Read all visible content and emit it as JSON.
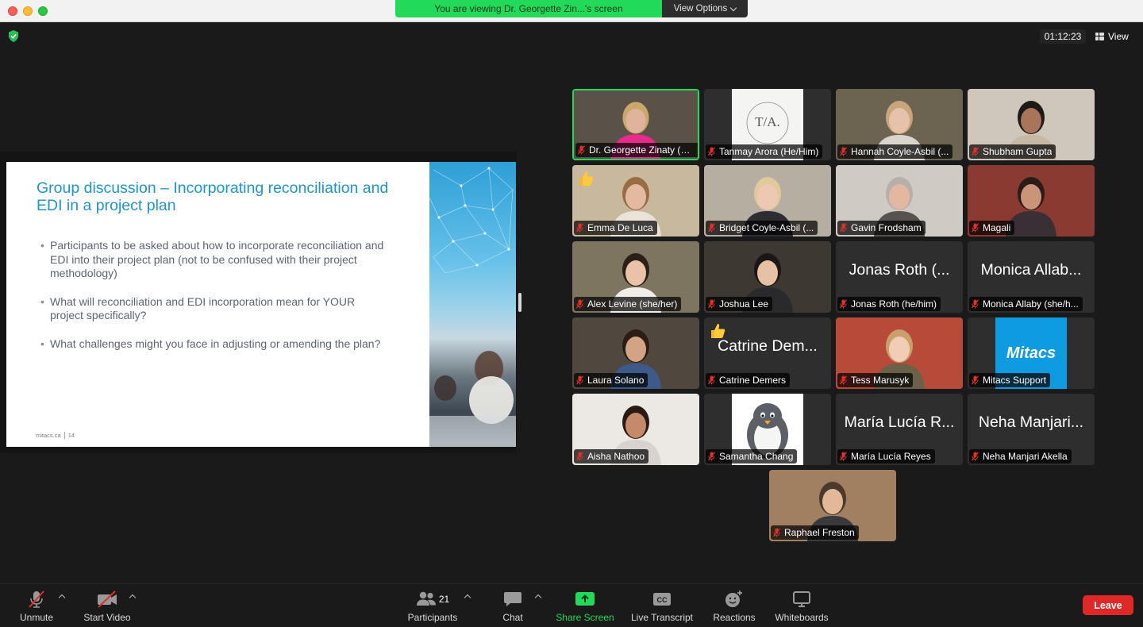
{
  "banner": {
    "text": "You are viewing Dr. Georgette Zin...'s screen",
    "view_options": "View Options"
  },
  "header": {
    "timer": "01:12:23",
    "view_label": "View"
  },
  "slide": {
    "title": "Group discussion – Incorporating reconciliation and EDI in a project plan",
    "bullets": [
      "Participants to be asked about how to incorporate reconciliation and EDI into their project plan (not to be confused with their project methodology)",
      "What will reconciliation and EDI incorporation mean for YOUR project specifically?",
      "What challenges might you face in adjusting or amending the plan?"
    ],
    "footer_site": "mitacs.ca",
    "footer_page": "14"
  },
  "participants": [
    {
      "name": "Dr. Georgette Zinaty (Sh...",
      "active": true,
      "video": "person",
      "skin": "#e0b49a",
      "shirt": "#e82b8a",
      "bg": "#5a5148",
      "hair": "#c9a86a"
    },
    {
      "name": "Tanmay Arora (He/Him)",
      "video": "logo",
      "logo_text": "T/A."
    },
    {
      "name": "Hannah Coyle-Asbil (...",
      "video": "person",
      "skin": "#e6c2ad",
      "shirt": "#d9d4cc",
      "bg": "#6c6450",
      "hair": "#c8a67a"
    },
    {
      "name": "Shubham Gupta",
      "video": "person",
      "skin": "#a9745a",
      "shirt": "#c7b8a4",
      "bg": "#cfc7bb",
      "hair": "#1e1a18"
    },
    {
      "name": "Emma De Luca",
      "video": "person",
      "skin": "#e3b99f",
      "shirt": "#e9e3d8",
      "bg": "#c8b99e",
      "hair": "#9a6c44",
      "thumb": true
    },
    {
      "name": "Bridget Coyle-Asbil (...",
      "video": "person",
      "skin": "#edc9b3",
      "shirt": "#2d2d33",
      "bg": "#b7aea2",
      "hair": "#e0c99a"
    },
    {
      "name": "Gavin Frodsham",
      "video": "person",
      "skin": "#e2b89f",
      "shirt": "#58524e",
      "bg": "#cfcac4",
      "hair": "#b8b0a8"
    },
    {
      "name": "Magali",
      "video": "person",
      "skin": "#c99478",
      "shirt": "#3a2f35",
      "bg": "#8a3a30",
      "hair": "#2a1d18"
    },
    {
      "name": "Alex Levine (she/her)",
      "video": "person",
      "skin": "#e9c2a7",
      "shirt": "#f0ede8",
      "bg": "#7d7560",
      "hair": "#2a201a"
    },
    {
      "name": "Joshua Lee",
      "video": "person",
      "skin": "#e6c1a3",
      "shirt": "#2a2a2c",
      "bg": "#3e3832",
      "hair": "#1a1716"
    },
    {
      "name": "Jonas Roth (he/him)",
      "video": "none",
      "big_name": "Jonas Roth (..."
    },
    {
      "name": "Monica Allaby (she/h...",
      "video": "none",
      "big_name": "Monica Allab..."
    },
    {
      "name": "Laura Solano",
      "video": "person",
      "skin": "#d2a486",
      "shirt": "#3e5a8a",
      "bg": "#50483e",
      "hair": "#2a1d16"
    },
    {
      "name": "Catrine Demers",
      "video": "none",
      "big_name": "Catrine Dem...",
      "thumb": true
    },
    {
      "name": "Tess Marusyk",
      "video": "person",
      "skin": "#f0cdb4",
      "shirt": "#6b6048",
      "bg": "#b84a3a",
      "hair": "#c8a06c"
    },
    {
      "name": "Mitacs Support",
      "video": "mitacs",
      "logo_text": "Mitacs"
    },
    {
      "name": "Aisha Nathoo",
      "video": "person",
      "skin": "#c48a6a",
      "shirt": "#d8d3cf",
      "bg": "#ece8e4",
      "hair": "#2a1a14"
    },
    {
      "name": "Samantha Chang",
      "video": "penguin"
    },
    {
      "name": "María Lucía Reyes",
      "video": "none",
      "big_name": "María Lucía R..."
    },
    {
      "name": "Neha Manjari Akella",
      "video": "none",
      "big_name": "Neha Manjari..."
    },
    {
      "name": "Raphael Freston",
      "video": "person",
      "skin": "#e2b899",
      "shirt": "#3a3a3c",
      "bg": "#a08060",
      "hair": "#4a3a2c"
    }
  ],
  "toolbar": {
    "unmute": "Unmute",
    "start_video": "Start Video",
    "participants": "Participants",
    "participants_count": "21",
    "chat": "Chat",
    "share_screen": "Share Screen",
    "live_transcript": "Live Transcript",
    "reactions": "Reactions",
    "whiteboards": "Whiteboards",
    "leave": "Leave"
  },
  "colors": {
    "accent_green": "#23d959",
    "leave_red": "#e02828",
    "slide_title_blue": "#1d96cf",
    "muted_mic_red": "#e0302a"
  }
}
